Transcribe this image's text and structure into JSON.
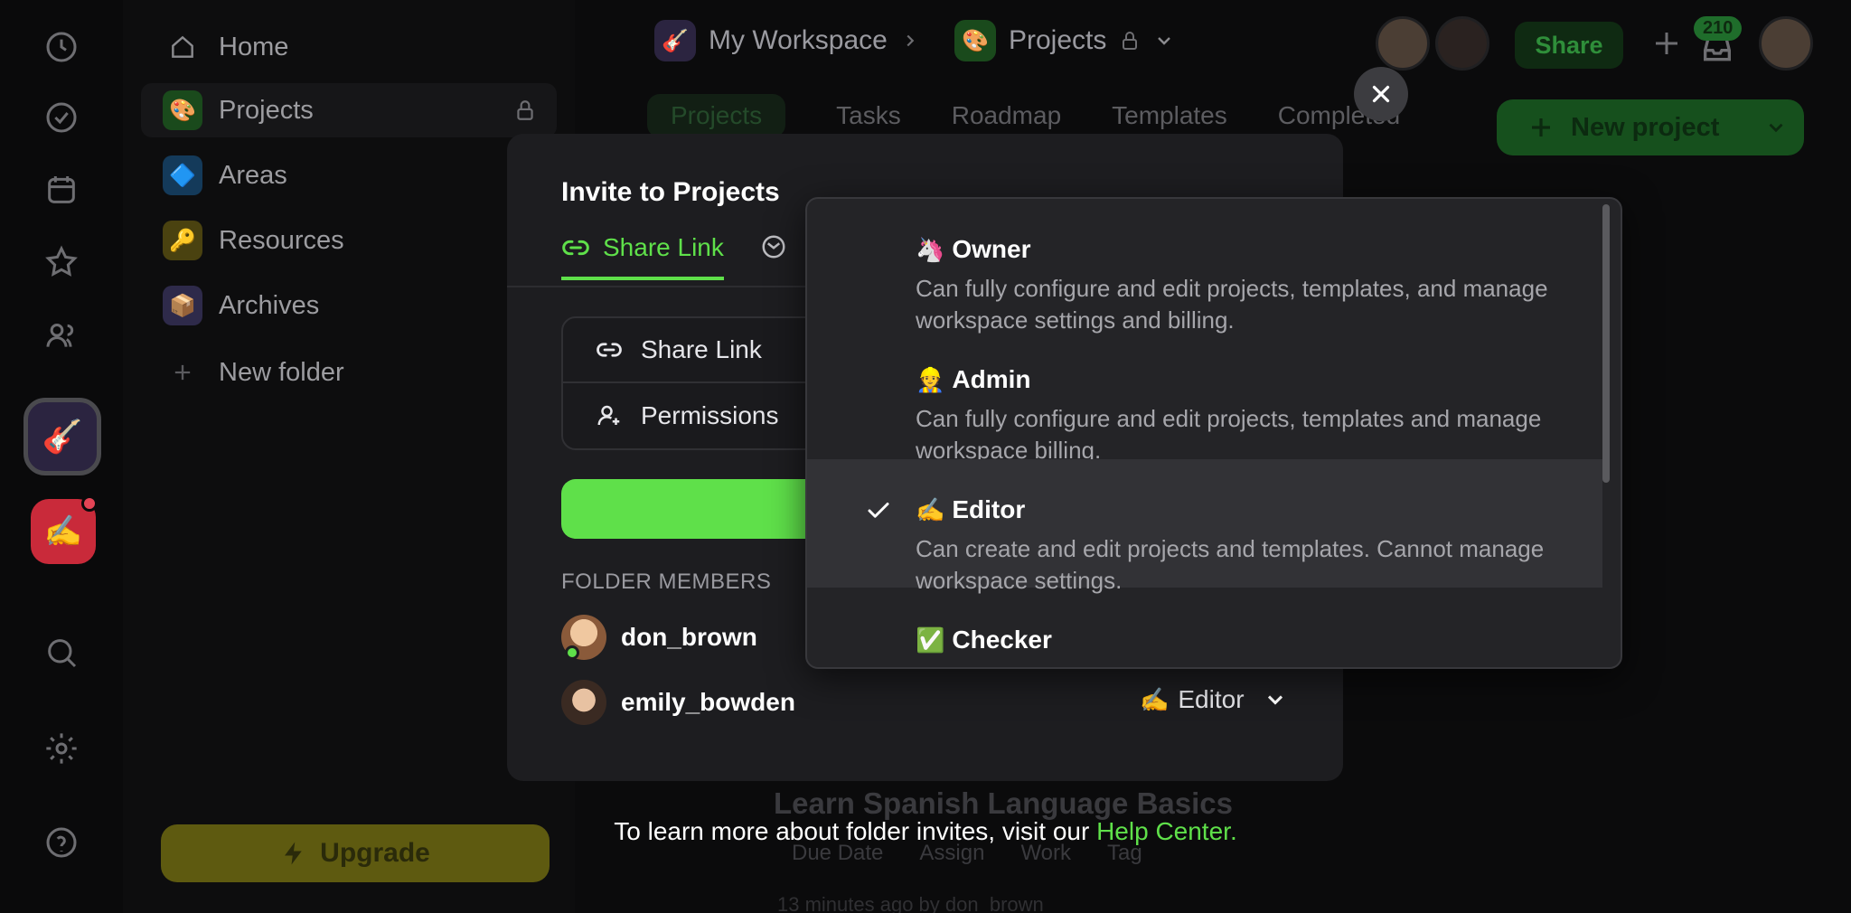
{
  "app": {
    "sidebar": {
      "items": [
        {
          "label": "Home",
          "icon": "home-icon"
        },
        {
          "label": "Projects",
          "icon": "projects-folder-icon",
          "emoji": "🎨"
        },
        {
          "label": "Areas",
          "icon": "areas-folder-icon",
          "emoji": "🔷"
        },
        {
          "label": "Resources",
          "icon": "resources-folder-icon",
          "emoji": "🔑"
        },
        {
          "label": "Archives",
          "icon": "archives-folder-icon",
          "emoji": "📦"
        },
        {
          "label": "New folder",
          "icon": "plus-icon"
        }
      ],
      "upgrade_label": "Upgrade"
    },
    "topbar": {
      "workspace": "My Workspace",
      "folder": "Projects",
      "share_label": "Share",
      "notification_count": "210"
    },
    "tabs": [
      "Projects",
      "Tasks",
      "Roadmap",
      "Templates",
      "Completed"
    ],
    "new_project_label": "New project",
    "card": {
      "title": "Learn Spanish Language Basics",
      "meta": [
        "Due Date",
        "Assign",
        "Work",
        "Tag"
      ],
      "time": "13 minutes ago by don_brown"
    }
  },
  "modal": {
    "title": "Invite to Projects",
    "tabs": {
      "share_link": "Share Link"
    },
    "segments": {
      "share_link": "Share Link",
      "permissions": "Permissions"
    },
    "members_label": "FOLDER MEMBERS",
    "members": [
      {
        "name": "don_brown"
      },
      {
        "name": "emily_bowden",
        "role": "Editor",
        "role_emoji": "✍️"
      }
    ]
  },
  "dropdown": {
    "options": [
      {
        "emoji": "🦄",
        "title": "Owner",
        "desc": "Can fully configure and edit projects, templates, and manage workspace settings and billing."
      },
      {
        "emoji": "👷",
        "title": "Admin",
        "desc": "Can fully configure and edit projects, templates and manage workspace billing."
      },
      {
        "emoji": "✍️",
        "title": "Editor",
        "desc": "Can create and edit projects and templates. Cannot manage workspace settings.",
        "selected": true
      },
      {
        "emoji": "✅",
        "title": "Checker",
        "desc": ""
      }
    ]
  },
  "footer": {
    "text": "To learn more about folder invites, visit our",
    "link": "Help Center."
  },
  "colors": {
    "accent": "#5fe04a",
    "modal_bg": "#1d1d20",
    "dropdown_bg": "#242427"
  }
}
